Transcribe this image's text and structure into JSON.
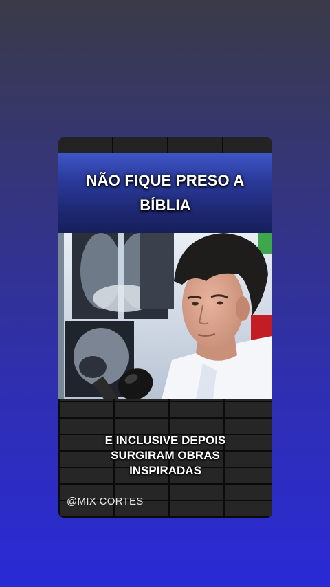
{
  "overlay": {
    "title_line1": "NÃO FIQUE PRESO A",
    "title_line2": "BÍBLIA",
    "caption_line1": "E INCLUSIVE DEPOIS",
    "caption_line2": "SURGIRAM OBRAS",
    "caption_line3": "INSPIRADAS",
    "watermark": "@MIX CORTES"
  },
  "colors": {
    "background_top": "#3a3a48",
    "background_bottom": "#2a2ad6",
    "title_band": "#2a3a9a",
    "text": "#ffffff"
  }
}
